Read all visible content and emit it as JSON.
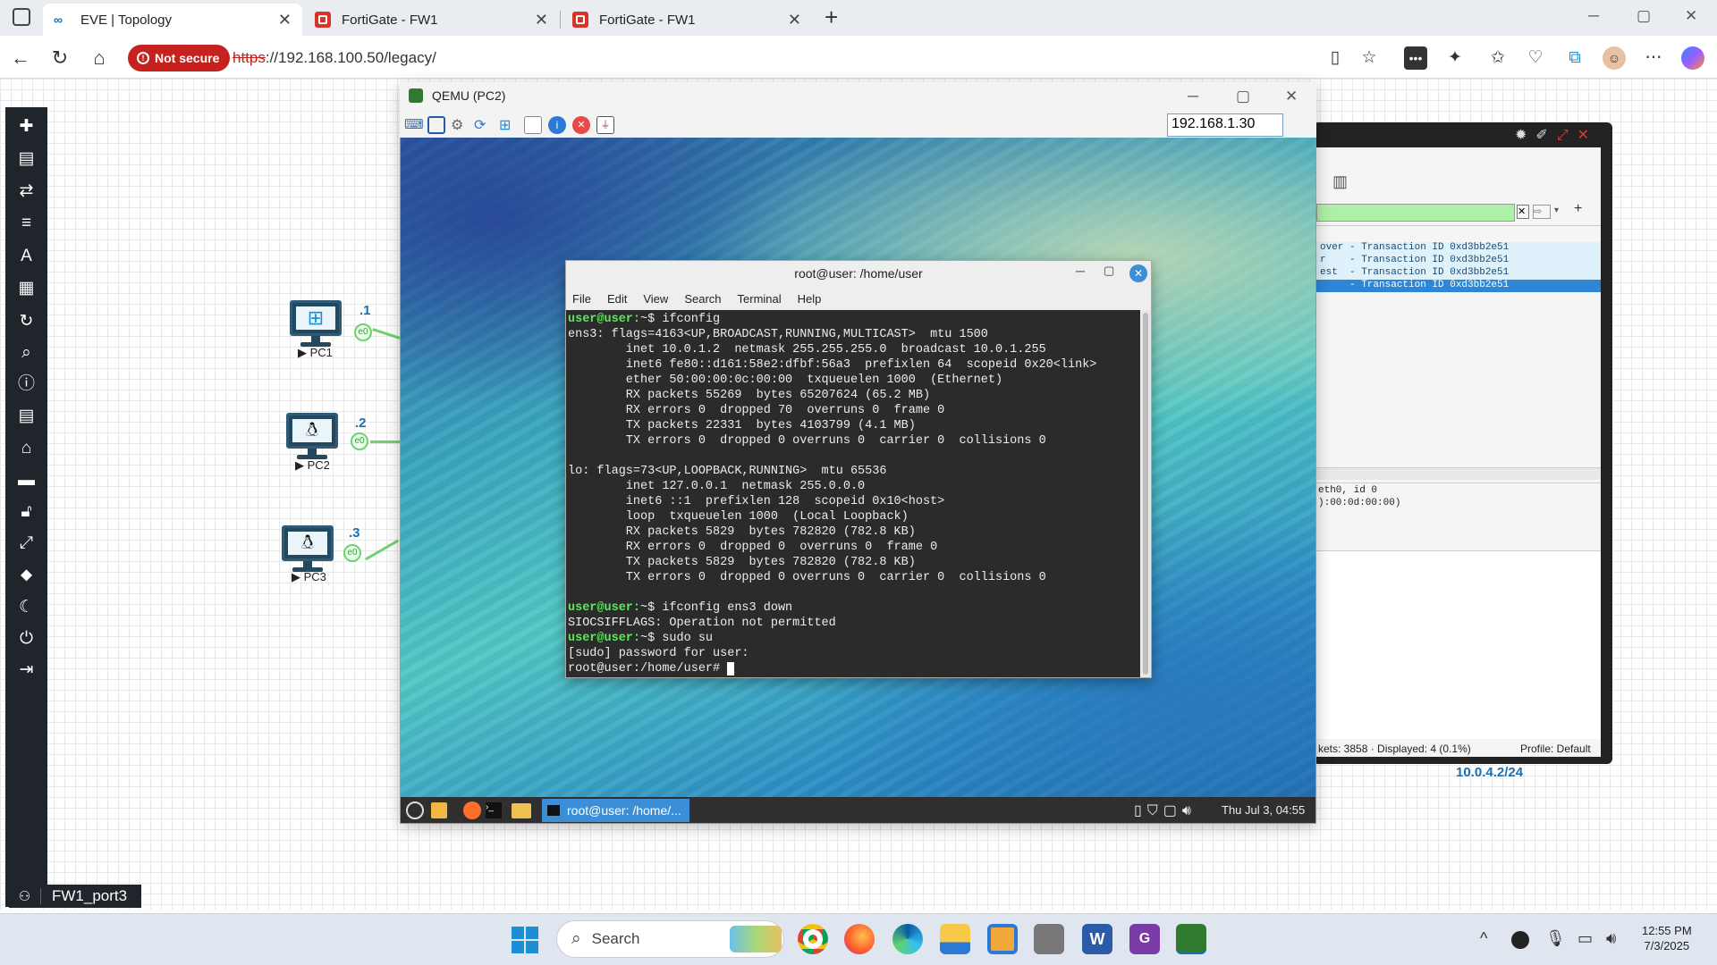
{
  "browser": {
    "tabs": [
      {
        "title": "EVE | Topology",
        "icon": "eve-icon"
      },
      {
        "title": "FortiGate - FW1",
        "icon": "fortigate-icon"
      },
      {
        "title": "FortiGate - FW1",
        "icon": "fortigate-icon"
      }
    ],
    "security_label": "Not secure",
    "url_scheme": "https",
    "url_rest": "://192.168.100.50/legacy/"
  },
  "eve": {
    "nodes": [
      {
        "name": "PC1",
        "ip_suffix": ".1",
        "iface": "e0",
        "os": "windows"
      },
      {
        "name": "PC2",
        "ip_suffix": ".2",
        "iface": "e0",
        "os": "linux"
      },
      {
        "name": "PC3",
        "ip_suffix": ".3",
        "iface": "e0",
        "os": "linux"
      }
    ],
    "network_label": "10.0.4.2/24",
    "port_label": "FW1_port3"
  },
  "wireshark": {
    "rows": [
      "over - Transaction ID 0xd3bb2e51",
      "r    - Transaction ID 0xd3bb2e51",
      "est  - Transaction ID 0xd3bb2e51",
      "     - Transaction ID 0xd3bb2e51"
    ],
    "detail_lines": [
      "eth0, id 0",
      "):00:0d:00:00)"
    ],
    "status": "kets: 3858 · Displayed: 4 (0.1%)",
    "profile": "Profile: Default"
  },
  "qemu": {
    "title": "QEMU (PC2)",
    "ip_field": "192.168.1.30",
    "taskbar_item": "root@user: /home/...",
    "clock": "Thu Jul 3, 04:55"
  },
  "terminal": {
    "title": "root@user: /home/user",
    "menu": [
      "File",
      "Edit",
      "View",
      "Search",
      "Terminal",
      "Help"
    ],
    "lines": [
      {
        "p": "user@user:",
        "t": "~$ ifconfig"
      },
      {
        "t": "ens3: flags=4163<UP,BROADCAST,RUNNING,MULTICAST>  mtu 1500"
      },
      {
        "t": "        inet 10.0.1.2  netmask 255.255.255.0  broadcast 10.0.1.255"
      },
      {
        "t": "        inet6 fe80::d161:58e2:dfbf:56a3  prefixlen 64  scopeid 0x20<link>"
      },
      {
        "t": "        ether 50:00:00:0c:00:00  txqueuelen 1000  (Ethernet)"
      },
      {
        "t": "        RX packets 55269  bytes 65207624 (65.2 MB)"
      },
      {
        "t": "        RX errors 0  dropped 70  overruns 0  frame 0"
      },
      {
        "t": "        TX packets 22331  bytes 4103799 (4.1 MB)"
      },
      {
        "t": "        TX errors 0  dropped 0 overruns 0  carrier 0  collisions 0"
      },
      {
        "t": ""
      },
      {
        "t": "lo: flags=73<UP,LOOPBACK,RUNNING>  mtu 65536"
      },
      {
        "t": "        inet 127.0.0.1  netmask 255.0.0.0"
      },
      {
        "t": "        inet6 ::1  prefixlen 128  scopeid 0x10<host>"
      },
      {
        "t": "        loop  txqueuelen 1000  (Local Loopback)"
      },
      {
        "t": "        RX packets 5829  bytes 782820 (782.8 KB)"
      },
      {
        "t": "        RX errors 0  dropped 0  overruns 0  frame 0"
      },
      {
        "t": "        TX packets 5829  bytes 782820 (782.8 KB)"
      },
      {
        "t": "        TX errors 0  dropped 0 overruns 0  carrier 0  collisions 0"
      },
      {
        "t": ""
      },
      {
        "p": "user@user:",
        "t": "~$ ifconfig ens3 down"
      },
      {
        "t": "SIOCSIFFLAGS: Operation not permitted"
      },
      {
        "p": "user@user:",
        "t": "~$ sudo su"
      },
      {
        "t": "[sudo] password for user:"
      },
      {
        "t": "root@user:/home/user# ",
        "cursor": true
      }
    ]
  },
  "windows": {
    "search_placeholder": "Search",
    "time": "12:55 PM",
    "date": "7/3/2025"
  },
  "colors": {
    "accent": "#1a6fb0",
    "not_secure": "#c5221f",
    "link_green": "#6cd46c",
    "prompt_green": "#5ce95c"
  }
}
